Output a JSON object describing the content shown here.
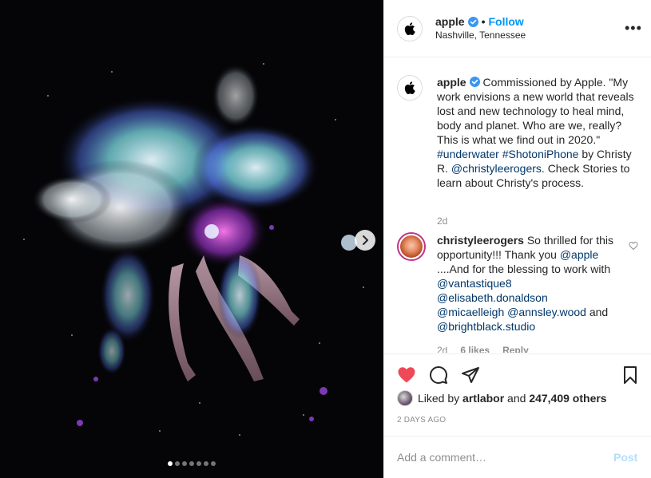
{
  "post": {
    "username": "apple",
    "follow_label": "Follow",
    "separator": "•",
    "location": "Nashville, Tennessee",
    "more_label": "•••"
  },
  "caption": {
    "username": "apple",
    "text1": " Commissioned by Apple. \"My work envisions a new world that reveals lost and new technology to heal mind, body and planet. Who are we, really? This is what we find out in 2020.\" ",
    "tag1": "#underwater",
    "space1": " ",
    "tag2": "#ShotoniPhone",
    "text2": " by Christy R. ",
    "mention": "@christyleerogers",
    "text3": ". Check Stories to learn about Christy's process.",
    "time": "2d"
  },
  "comment": {
    "username": "christyleerogers",
    "text1": " So thrilled for this opportunity!!! Thank you ",
    "mention1": "@apple",
    "text2": " ....And for the blessing to work with ",
    "mention2": "@vantastique8",
    "mention3": "@elisabeth.donaldson",
    "mention4": "@micaelleigh",
    "mention5": "@annsley.wood",
    "text3": " and ",
    "mention6": "@brightblack.studio",
    "time": "2d",
    "likes": "6 likes",
    "reply_label": "Reply"
  },
  "likes": {
    "prefix": "Liked by ",
    "user": "artlabor",
    "middle": " and ",
    "count": "247,409 others"
  },
  "date": "2 DAYS AGO",
  "add_comment": {
    "placeholder": "Add a comment…",
    "post_label": "Post"
  },
  "carousel": {
    "total": 7,
    "active_index": 0
  },
  "icons": {
    "verified": "verified-badge-icon",
    "heart": "heart-filled-icon",
    "comment": "comment-bubble-icon",
    "share": "paper-plane-icon",
    "save": "bookmark-icon",
    "next": "chevron-right-icon",
    "logo": "apple-logo-icon"
  },
  "colors": {
    "accent": "#0095f6",
    "heart": "#ed4956",
    "link": "#00376b",
    "muted": "#8e8e8e"
  }
}
